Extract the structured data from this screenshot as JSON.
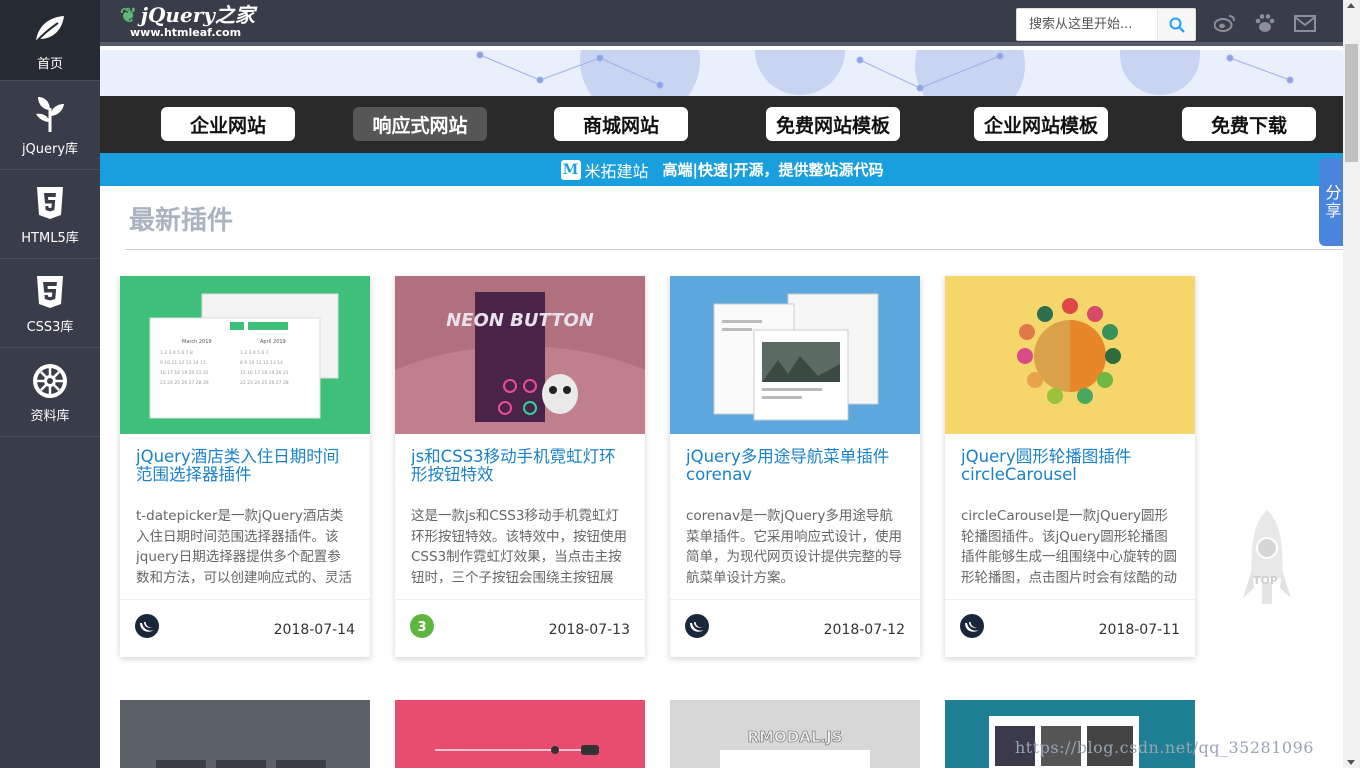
{
  "sidebar": {
    "items": [
      {
        "label": "首页",
        "icon": "leaf-icon"
      },
      {
        "label": "jQuery库",
        "icon": "sprout-icon"
      },
      {
        "label": "HTML5库",
        "icon": "html5-icon"
      },
      {
        "label": "CSS3库",
        "icon": "css3-icon"
      },
      {
        "label": "资料库",
        "icon": "empire-icon"
      }
    ]
  },
  "header": {
    "logo_main": "jQuery之家",
    "logo_sub": "www.htmleaf.com",
    "search_placeholder": "搜索从这里开始...",
    "icons": [
      "weibo-icon",
      "paw-icon",
      "mail-icon"
    ]
  },
  "nav": {
    "buttons": [
      "企业网站",
      "响应式网站",
      "商城网站",
      "免费网站模板",
      "企业网站模板",
      "免费下载"
    ],
    "active_index": 1
  },
  "ad": {
    "brand": "米拓建站",
    "slogan": "高端|快速|开源，提供整站源代码"
  },
  "section": {
    "title": "最新插件"
  },
  "share": {
    "label": "分享"
  },
  "rocket": {
    "label": "TOP"
  },
  "cards": [
    {
      "title": "jQuery酒店类入住日期时间范围选择器插件",
      "desc": "t-datepicker是一款jQuery酒店类入住日期时间范围选择器插件。该jquery日期选择器提供多个配置参数和方法，可以创建响应式的、灵活的日期范围选择器。",
      "date": "2018-07-14",
      "thumb_color": "#3fc07a",
      "thumb_label_1": "March 2019",
      "thumb_label_2": "April 2019",
      "lib": "jquery"
    },
    {
      "title": "js和CSS3移动手机霓虹灯环形按钮特效",
      "desc": "这是一款js和CSS3移动手机霓虹灯环形按钮特效。该特效中，按钮使用CSS3制作霓虹灯效果，当点击主按钮时，三个子按钮会围绕主按钮展开。",
      "date": "2018-07-13",
      "thumb_color": "#b0707e",
      "thumb_label_1": "NEON BUTTON",
      "lib": "css3"
    },
    {
      "title": "jQuery多用途导航菜单插件corenav",
      "desc": "corenav是一款jQuery多用途导航菜单插件。它采用响应式设计，使用简单，为现代网页设计提供完整的导航菜单设计方案。",
      "date": "2018-07-12",
      "thumb_color": "#5ba7de",
      "lib": "jquery"
    },
    {
      "title": "jQuery圆形轮播图插件circleCarousel",
      "desc": "circleCarousel是一款jQuery圆形轮播图插件。该jQuery圆形轮播图插件能够生成一组围绕中心旋转的圆形轮播图，点击图片时会有炫酷的动画效果。",
      "date": "2018-07-11",
      "thumb_color": "#f5d66b",
      "lib": "jquery"
    }
  ],
  "row2": {
    "thumbs": [
      "#5c6068",
      "#e84c70",
      "#d7d7d7",
      "#1f7f95"
    ],
    "labels": [
      "",
      "",
      "RMODAL.JS",
      ""
    ]
  },
  "watermark": "https://blog.csdn.net/qq_35281096"
}
